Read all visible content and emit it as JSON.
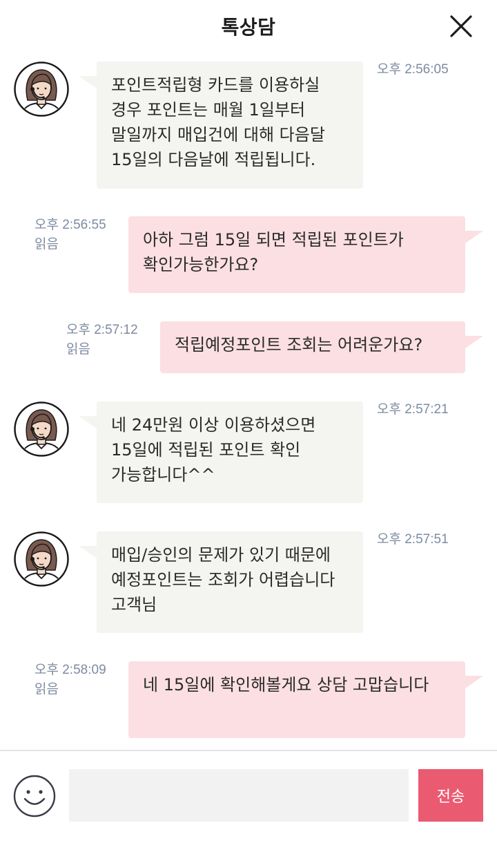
{
  "header": {
    "title": "톡상담",
    "close_icon": "close-icon"
  },
  "messages": [
    {
      "sender": "agent",
      "time": "오후 2:56:05",
      "read": "",
      "text": "포인트적립형 카드를 이용하실 경우 포인트는 매월 1일부터 말일까지 매입건에 대해 다음달 15일의 다음날에 적립됩니다."
    },
    {
      "sender": "user",
      "time": "오후 2:56:55",
      "read": "읽음",
      "text": "아하 그럼 15일 되면 적립된 포인트가 확인가능한가요?"
    },
    {
      "sender": "user",
      "time": "오후 2:57:12",
      "read": "읽음",
      "text": "적립예정포인트 조회는 어려운가요?"
    },
    {
      "sender": "agent",
      "time": "오후 2:57:21",
      "read": "",
      "text": "네 24만원 이상 이용하셨으면 15일에 적립된 포인트 확인 가능합니다^^"
    },
    {
      "sender": "agent",
      "time": "오후 2:57:51",
      "read": "",
      "text": "매입/승인의 문제가 있기 때문에 예정포인트는 조회가 어렵습니다 고객님"
    },
    {
      "sender": "user",
      "time": "오후 2:58:09",
      "read": "읽음",
      "text": "네 15일에 확인해볼게요 상담 고맙습니다"
    }
  ],
  "composer": {
    "emoji_icon": "smiley-icon",
    "input_value": "",
    "input_placeholder": "",
    "send_label": "전송"
  },
  "colors": {
    "agent_bubble": "#f4f4f0",
    "user_bubble": "#fbdfe2",
    "send_button": "#ea5b72",
    "timestamp": "#7d8aa0"
  }
}
